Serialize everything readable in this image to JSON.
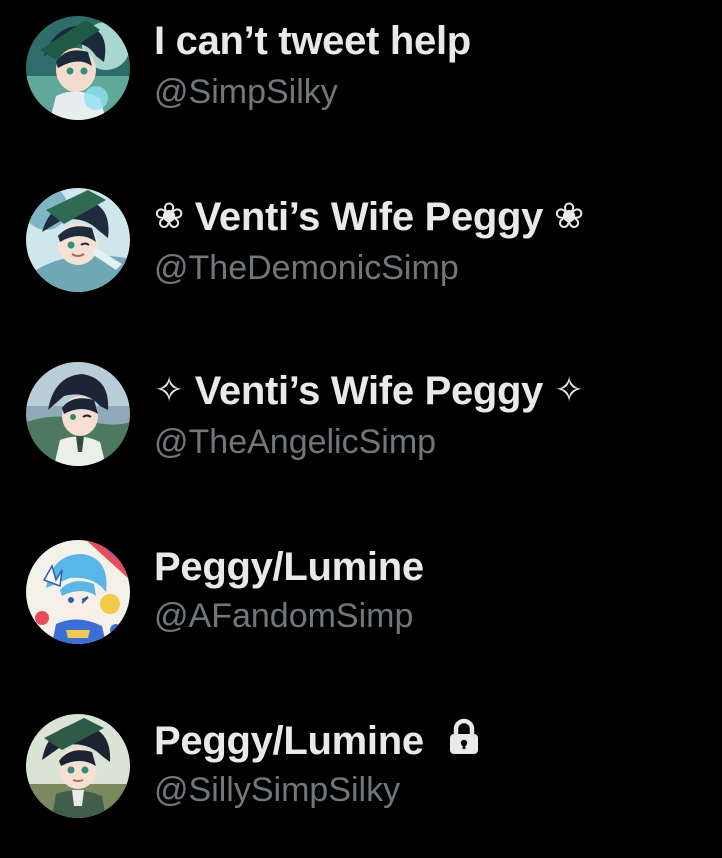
{
  "accounts": [
    {
      "display_name": "I can’t tweet help",
      "handle": "@SimpSilky",
      "avatar_icon": "anime-character-avatar",
      "protected": false
    },
    {
      "deco_left": "❀",
      "display_name": "Venti’s Wife Peggy",
      "deco_right": "❀",
      "handle": "@TheDemonicSimp",
      "avatar_icon": "anime-character-avatar",
      "protected": false
    },
    {
      "deco_left": "✧",
      "display_name": "Venti’s Wife Peggy",
      "deco_right": "✧",
      "handle": "@TheAngelicSimp",
      "avatar_icon": "anime-character-avatar",
      "protected": false
    },
    {
      "display_name": "Peggy/Lumine",
      "handle": "@AFandomSimp",
      "avatar_icon": "anime-character-avatar",
      "protected": false
    },
    {
      "display_name": "Peggy/Lumine",
      "handle": "@SillySimpSilky",
      "avatar_icon": "anime-character-avatar",
      "protected": true,
      "lock_icon": "lock-icon"
    }
  ],
  "colors": {
    "background": "#000000",
    "display_name": "#e7e9ea",
    "handle": "#71767b"
  }
}
